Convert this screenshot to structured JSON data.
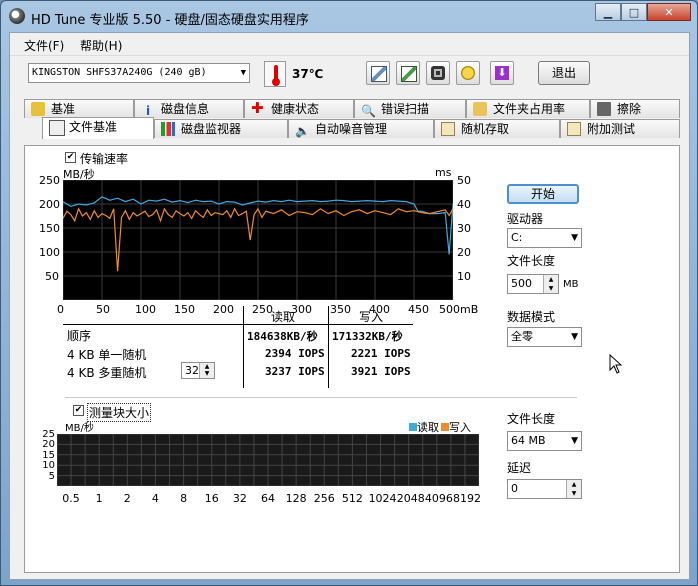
{
  "window": {
    "title": "HD Tune 专业版 5.50 - 硬盘/固态硬盘实用程序"
  },
  "menu": {
    "file": "文件(F)",
    "help": "帮助(H)"
  },
  "toolbar": {
    "drive": "KINGSTON SHFS37A240G (240 gB)",
    "temperature": "37℃",
    "exit": "退出",
    "icons": [
      "copy-icon",
      "copy-info-icon",
      "camera-icon",
      "coins-icon",
      "download-icon"
    ]
  },
  "tabs_top": [
    "基准",
    "磁盘信息",
    "健康状态",
    "错误扫描",
    "文件夹占用率",
    "擦除"
  ],
  "tabs_bottom": [
    "文件基准",
    "磁盘监视器",
    "自动噪音管理",
    "随机存取",
    "附加测试"
  ],
  "transfer": {
    "checkbox_label": "传输速率",
    "unit_left": "MB/秒",
    "unit_right": "ms",
    "y_left": [
      "250",
      "200",
      "150",
      "100",
      "50"
    ],
    "y_right": [
      "50",
      "40",
      "30",
      "20",
      "10"
    ],
    "x_ticks": [
      "0",
      "50",
      "100",
      "150",
      "200",
      "250",
      "300",
      "350",
      "400",
      "450",
      "500mB"
    ]
  },
  "results": {
    "col_read": "读取",
    "col_write": "写入",
    "rows": [
      {
        "label": "顺序",
        "read": "184638KB/秒",
        "write": "171332KB/秒"
      },
      {
        "label": "4 KB 单一随机",
        "read": "2394 IOPS",
        "write": "2221 IOPS"
      },
      {
        "label": "4 KB 多重随机",
        "read": "3237 IOPS",
        "write": "3921 IOPS"
      }
    ],
    "queue_depth": "32"
  },
  "side": {
    "start": "开始",
    "drive_label": "驱动器",
    "drive_value": "C:",
    "file_length_label": "文件长度",
    "file_length_value": "500",
    "file_length_unit": "MB",
    "data_mode_label": "数据模式",
    "data_mode_value": "全零"
  },
  "block": {
    "checkbox_label": "测量块大小",
    "unit": "MB/秒",
    "legend_read": "读取",
    "legend_write": "写入",
    "y_ticks": [
      "25",
      "20",
      "15",
      "10",
      "5"
    ],
    "x_ticks": [
      "0.5",
      "1",
      "2",
      "4",
      "8",
      "16",
      "32",
      "64",
      "128",
      "256",
      "512",
      "1024",
      "2048",
      "4096",
      "8192"
    ],
    "file_length_label": "文件长度",
    "file_length_value": "64 MB",
    "delay_label": "延迟",
    "delay_value": "0"
  },
  "colors": {
    "read": "#3fa9e0",
    "write": "#f08a2e",
    "chart_bg": "#000000",
    "grid": "#3a3a3a"
  },
  "chart_data": [
    {
      "type": "line",
      "title": "",
      "xlabel": "",
      "ylabel": "MB/秒",
      "xlim": [
        0,
        500
      ],
      "ylim": [
        0,
        250
      ],
      "grid": true,
      "legend": "none",
      "series": [
        {
          "name": "读取",
          "x": [
            0,
            10,
            20,
            30,
            40,
            50,
            60,
            70,
            80,
            90,
            100,
            110,
            120,
            130,
            140,
            150,
            160,
            170,
            180,
            190,
            200,
            210,
            220,
            230,
            240,
            250,
            260,
            270,
            280,
            290,
            300,
            310,
            320,
            330,
            340,
            350,
            360,
            370,
            380,
            390,
            400,
            410,
            420,
            430,
            440,
            450,
            455,
            460,
            470,
            480,
            490,
            495,
            500
          ],
          "values": [
            205,
            195,
            200,
            198,
            202,
            215,
            208,
            212,
            205,
            210,
            200,
            208,
            206,
            210,
            204,
            207,
            203,
            208,
            205,
            206,
            200,
            205,
            204,
            198,
            202,
            206,
            204,
            207,
            205,
            208,
            205,
            206,
            207,
            205,
            206,
            208,
            207,
            205,
            206,
            207,
            206,
            205,
            207,
            206,
            205,
            200,
            185,
            185,
            180,
            180,
            182,
            95,
            200
          ]
        },
        {
          "name": "写入",
          "x": [
            0,
            5,
            10,
            15,
            20,
            25,
            30,
            35,
            40,
            45,
            50,
            55,
            60,
            65,
            70,
            75,
            80,
            85,
            90,
            95,
            100,
            105,
            110,
            115,
            120,
            125,
            130,
            135,
            140,
            145,
            150,
            155,
            160,
            165,
            170,
            175,
            180,
            185,
            190,
            195,
            200,
            205,
            210,
            215,
            220,
            225,
            230,
            235,
            240,
            245,
            250,
            255,
            260,
            270,
            280,
            290,
            300,
            310,
            320,
            330,
            340,
            350,
            360,
            370,
            380,
            390,
            400,
            410,
            420,
            430,
            440,
            450,
            460,
            470,
            480,
            490,
            495,
            500
          ],
          "values": [
            170,
            185,
            178,
            165,
            190,
            175,
            182,
            168,
            186,
            172,
            180,
            176,
            170,
            190,
            60,
            172,
            186,
            168,
            182,
            175,
            180,
            185,
            174,
            178,
            188,
            165,
            190,
            178,
            172,
            186,
            180,
            175,
            182,
            170,
            186,
            178,
            172,
            188,
            176,
            182,
            180,
            178,
            186,
            172,
            190,
            176,
            180,
            185,
            125,
            178,
            190,
            172,
            185,
            180,
            188,
            176,
            184,
            182,
            178,
            190,
            180,
            186,
            176,
            184,
            188,
            180,
            186,
            182,
            178,
            190,
            184,
            186,
            182,
            180,
            184,
            188,
            176,
            190
          ]
        }
      ]
    },
    {
      "type": "bar",
      "title": "",
      "xlabel": "",
      "ylabel": "MB/秒",
      "categories": [
        "0.5",
        "1",
        "2",
        "4",
        "8",
        "16",
        "32",
        "64",
        "128",
        "256",
        "512",
        "1024",
        "2048",
        "4096",
        "8192"
      ],
      "ylim": [
        0,
        25
      ],
      "grid": true,
      "legend": "top-right",
      "series": [
        {
          "name": "读取",
          "values": []
        },
        {
          "name": "写入",
          "values": []
        }
      ]
    }
  ]
}
